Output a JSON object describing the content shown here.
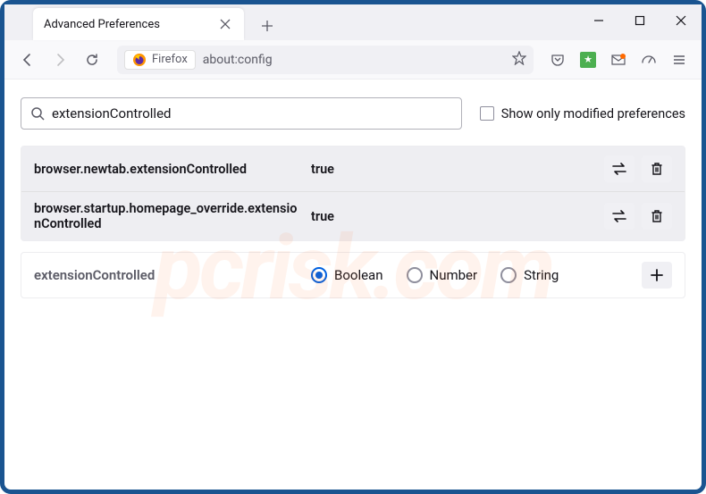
{
  "tab": {
    "title": "Advanced Preferences"
  },
  "urlbar": {
    "identity": "Firefox",
    "url": "about:config"
  },
  "search": {
    "value": "extensionControlled",
    "filter_label": "Show only modified preferences"
  },
  "prefs": [
    {
      "name": "browser.newtab.extensionControlled",
      "value": "true"
    },
    {
      "name": "browser.startup.homepage_override.extensionControlled",
      "value": "true"
    }
  ],
  "new_pref": {
    "name": "extensionControlled",
    "types": [
      "Boolean",
      "Number",
      "String"
    ],
    "selected": "Boolean"
  },
  "watermark": "pcrisk.com"
}
